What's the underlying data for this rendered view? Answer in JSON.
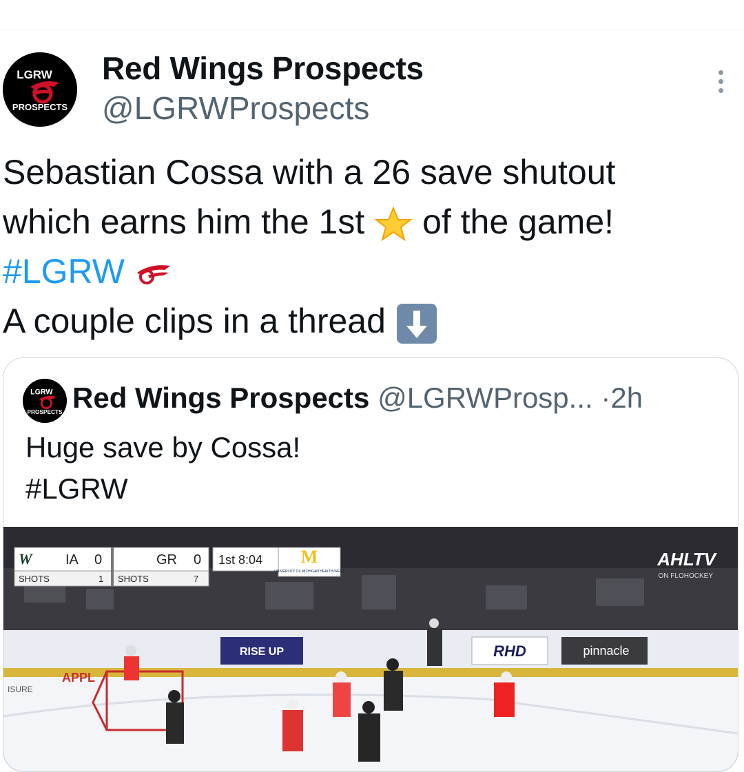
{
  "tweet": {
    "author_name": "Red Wings Prospects",
    "author_handle": "@LGRWProspects",
    "avatar_text_top": "LGRW",
    "avatar_text_bottom": "PROSPECTS",
    "text_line1": "Sebastian Cossa with a 26 save shutout",
    "text_line2_before": "which earns him the 1st",
    "text_line2_after": "of the game!",
    "hashtag": "#LGRW",
    "text_line4": "A couple clips in a thread",
    "icons": [
      "more-icon",
      "star-emoji",
      "red-wings-logo-emoji",
      "down-arrow-emoji"
    ]
  },
  "quote": {
    "author_name": "Red Wings Prospects",
    "author_handle": "@LGRWProsp...",
    "separator": "·",
    "time": "2h",
    "line1": "Huge save by Cossa!",
    "line2": "#LGRW"
  },
  "video": {
    "team1": "IA",
    "score1": "0",
    "team2": "GR",
    "score2": "0",
    "period_clock": "1st 8:04",
    "shots_label1": "SHOTS",
    "shots1": "1",
    "shots_label2": "SHOTS",
    "shots2": "7",
    "sponsor_m": "M",
    "sponsor_michigan": "UNIVERSITY OF MICHIGAN HEALTH-WEST",
    "broadcaster": "AHLTV",
    "broadcaster_sub": "ON FLOHOCKEY",
    "board_riseup": "RISE UP",
    "board_rhd": "RHD",
    "board_pinnacle": "pinnacle",
    "board_leisure": "ISURE",
    "board_apple": "APPL",
    "colors": {
      "accent_blue": "#1d9bf0",
      "red_wings_red": "#ce1126"
    }
  }
}
